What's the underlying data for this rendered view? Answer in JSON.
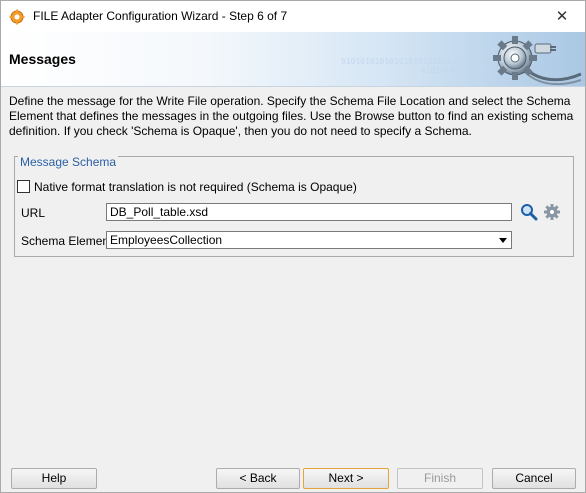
{
  "window": {
    "title": "FILE Adapter Configuration Wizard - Step 6 of 7",
    "close_glyph": "✕"
  },
  "header": {
    "title": "Messages",
    "binary_line1": "01010101010101010101010101",
    "binary_line2": "0101010101010",
    "icon": "gear-plug-icon"
  },
  "description": "Define the message for the Write File operation.  Specify the Schema File Location and select the Schema Element that defines the messages in the outgoing files. Use the Browse button to find an existing schema definition. If you check 'Schema is Opaque', then you do not need to specify a Schema.",
  "message_schema": {
    "legend": "Message Schema",
    "opaque_checkbox": {
      "label": "Native format translation is not required (Schema is Opaque)",
      "checked": false
    },
    "url": {
      "label": "URL",
      "value": "DB_Poll_table.xsd"
    },
    "schema_element": {
      "label": "Schema Element",
      "selected": "EmployeesCollection"
    }
  },
  "buttons": {
    "help": "Help",
    "back": "< Back",
    "next": "Next >",
    "finish": "Finish",
    "cancel": "Cancel"
  }
}
